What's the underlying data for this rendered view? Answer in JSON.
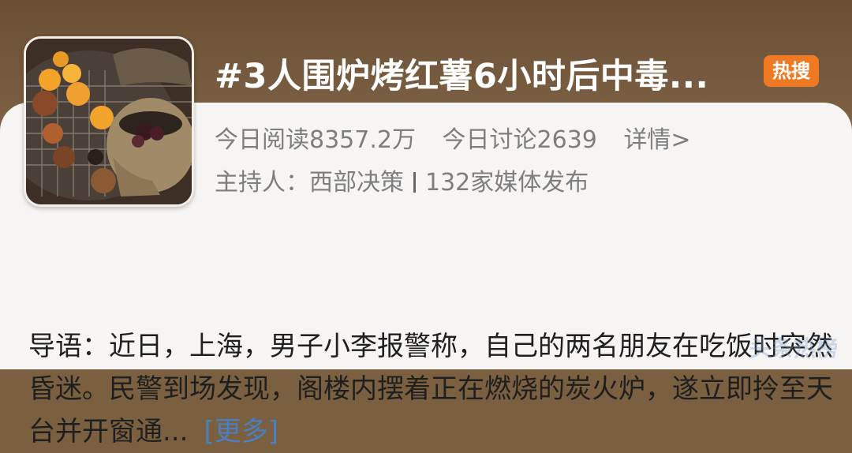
{
  "topic": {
    "title": "#3人围炉烤红薯6小时后中毒...",
    "badge": "热搜",
    "reads": "今日阅读8357.2万",
    "discussion": "今日讨论2639",
    "details_link": "详情>",
    "host_label": "主持人：西部决策",
    "publishers": "132家媒体发布",
    "summary": "导语：近日，上海，男子小李报警称，自己的两名朋友在吃饭时突然昏迷。民警到场发现，阁楼内摆着正在燃烧的炭火炉，遂立即拎至天台并开窗通...",
    "more_link": "[更多]",
    "thumbnail_icon": "charcoal-stove-thumbnail",
    "badge_color": "#f07a24"
  },
  "watermark": {
    "text": "头条热榜"
  }
}
